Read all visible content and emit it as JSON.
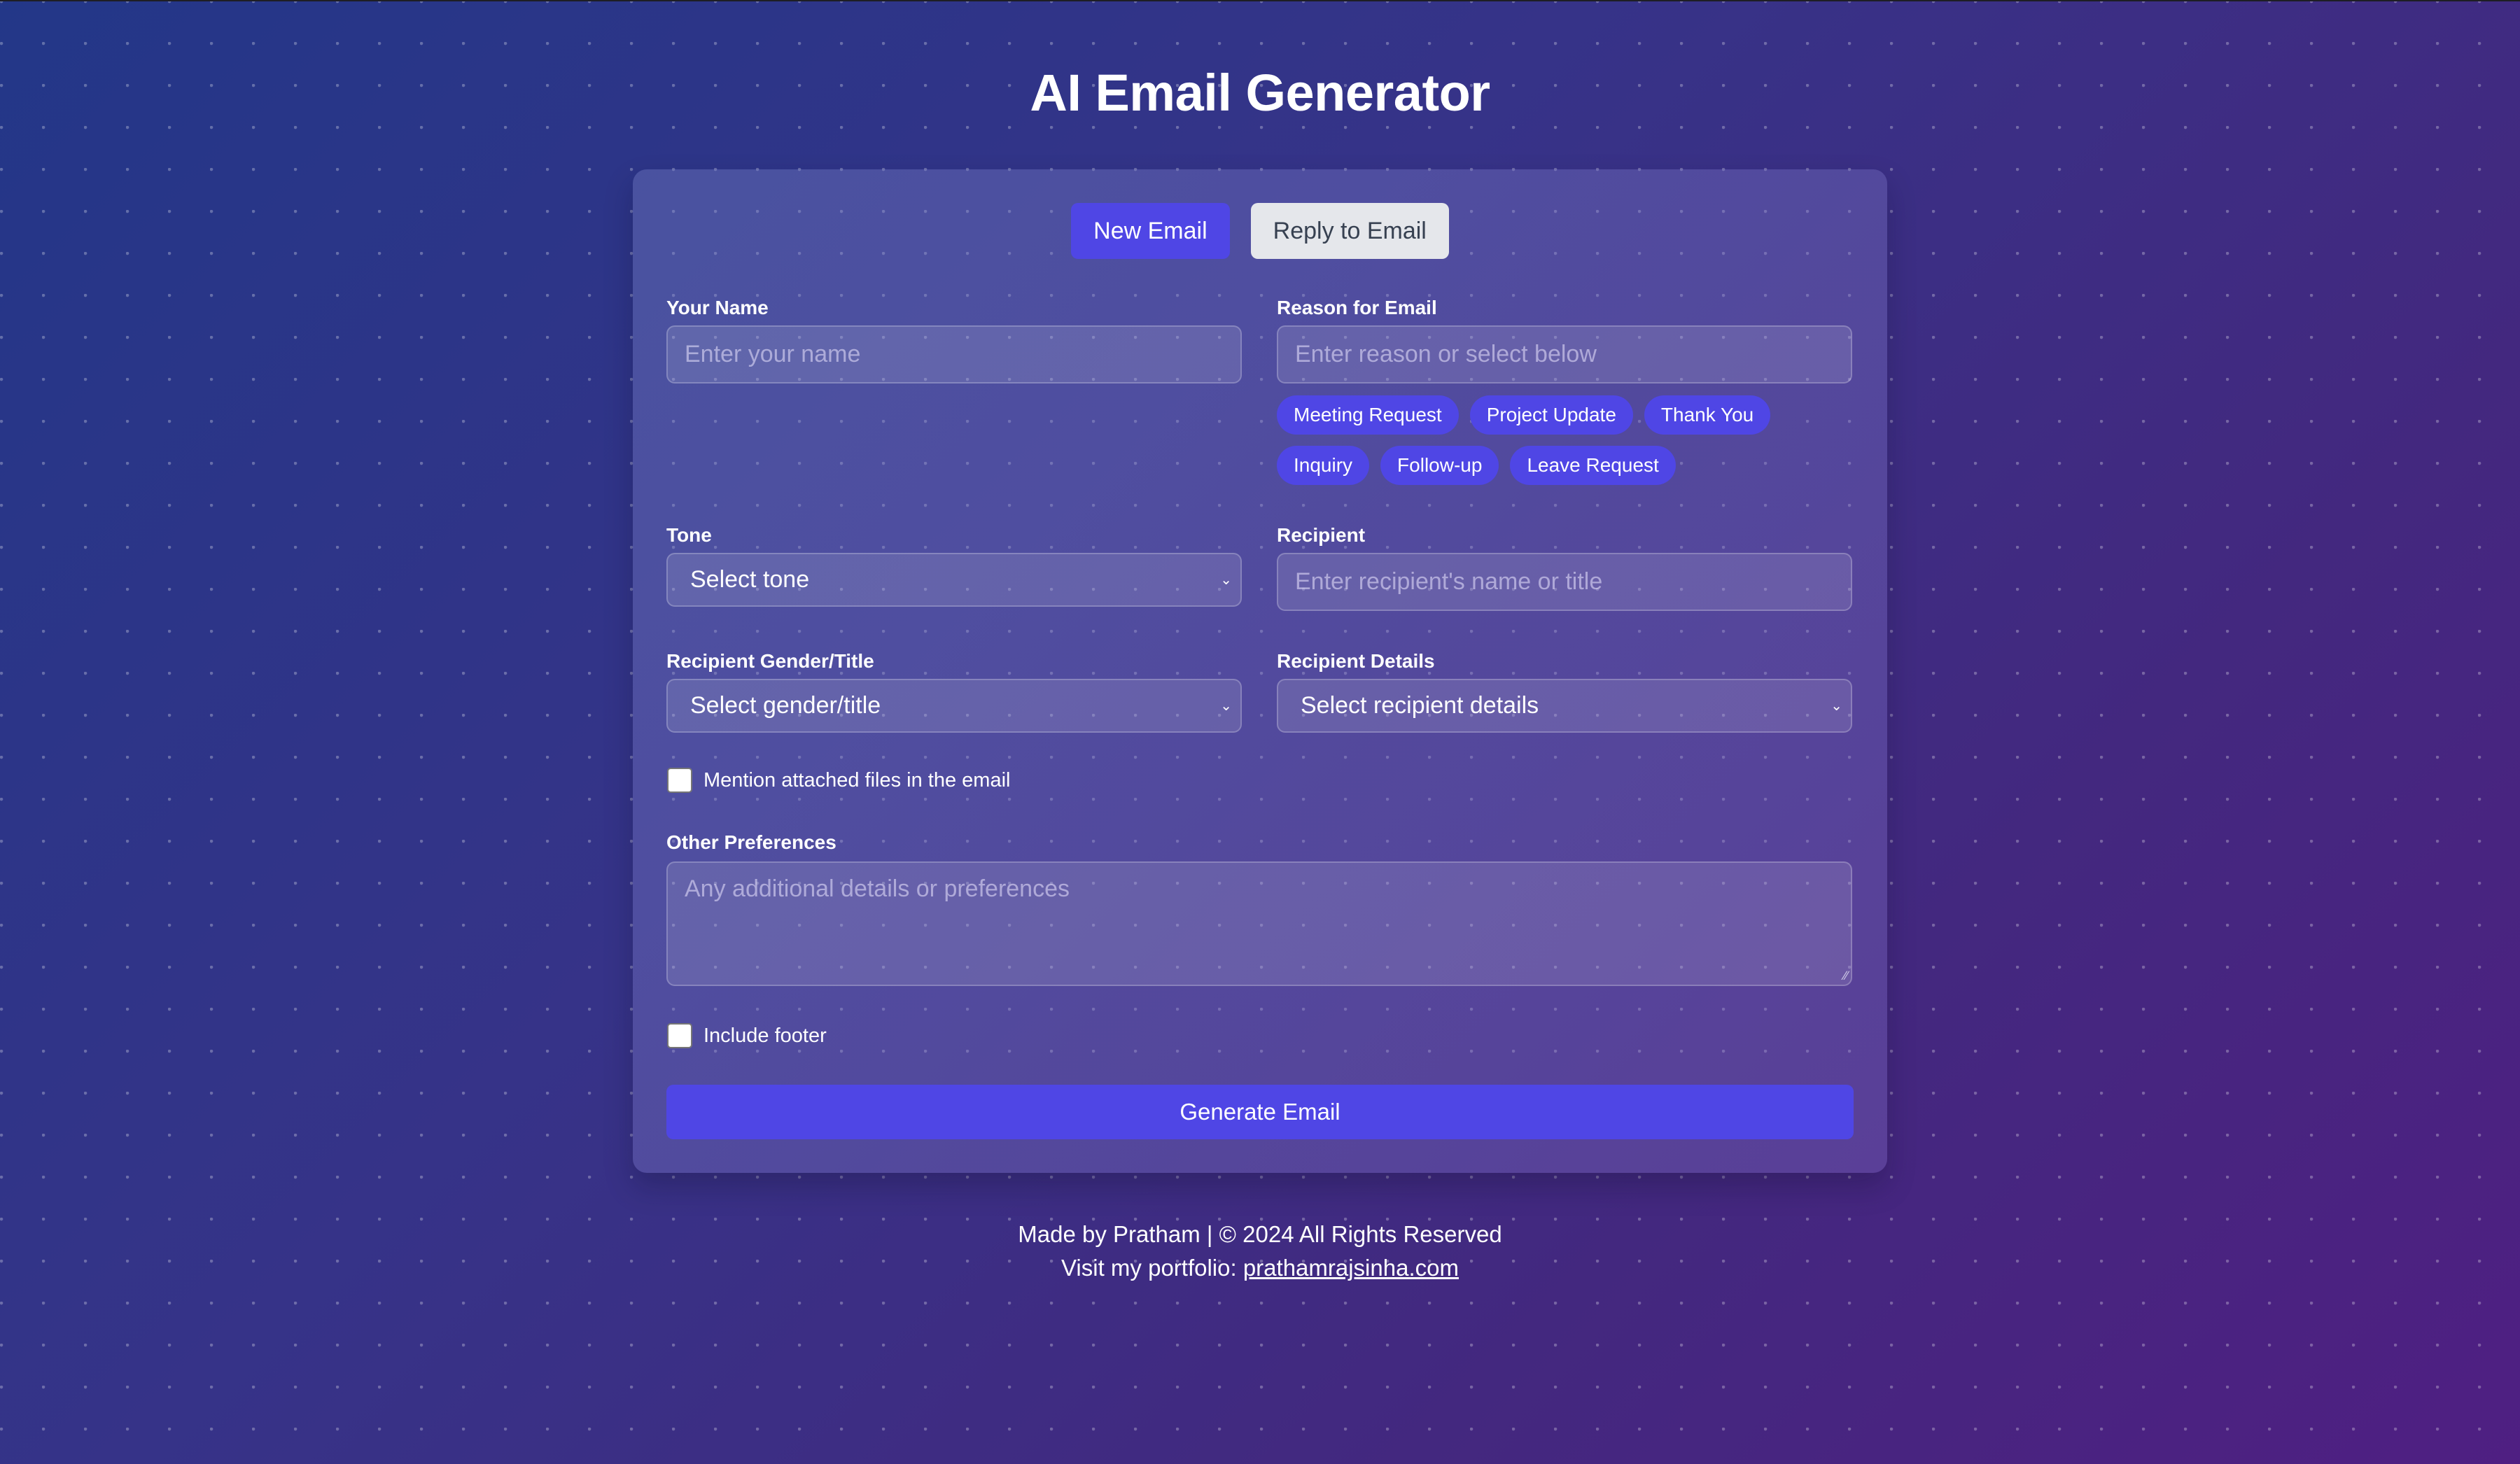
{
  "page": {
    "title": "AI Email Generator"
  },
  "mode_toggle": {
    "new_email_label": "New Email",
    "reply_email_label": "Reply to Email",
    "active": "New Email"
  },
  "form": {
    "your_name": {
      "label": "Your Name",
      "value": "",
      "placeholder": "Enter your name"
    },
    "reason": {
      "label": "Reason for Email",
      "value": "",
      "placeholder": "Enter reason or select below",
      "chips": [
        "Meeting Request",
        "Project Update",
        "Thank You",
        "Inquiry",
        "Follow-up",
        "Leave Request"
      ]
    },
    "tone": {
      "label": "Tone",
      "selected": "Select tone"
    },
    "recipient": {
      "label": "Recipient",
      "value": "",
      "placeholder": "Enter recipient's name or title"
    },
    "recipient_gender": {
      "label": "Recipient Gender/Title",
      "selected": "Select gender/title"
    },
    "recipient_details": {
      "label": "Recipient Details",
      "selected": "Select recipient details"
    },
    "mention_attachments": {
      "label": "Mention attached files in the email",
      "checked": false
    },
    "other_preferences": {
      "label": "Other Preferences",
      "value": "",
      "placeholder": "Any additional details or preferences"
    },
    "include_footer": {
      "label": "Include footer",
      "checked": false
    },
    "generate_label": "Generate Email"
  },
  "footer": {
    "credit": "Made by Pratham | © 2024 All Rights Reserved",
    "portfolio_prefix": "Visit my portfolio: ",
    "portfolio_link": "prathamrajsinha.com"
  },
  "colors": {
    "accent": "#4f46e5",
    "secondary_button": "#e5e7eb",
    "secondary_button_text": "#374151",
    "background_start": "#233788",
    "background_end": "#4f1f82"
  },
  "icons": {
    "select_chevron": "chevron-down-icon",
    "textarea_resize": "resize-handle-icon"
  }
}
